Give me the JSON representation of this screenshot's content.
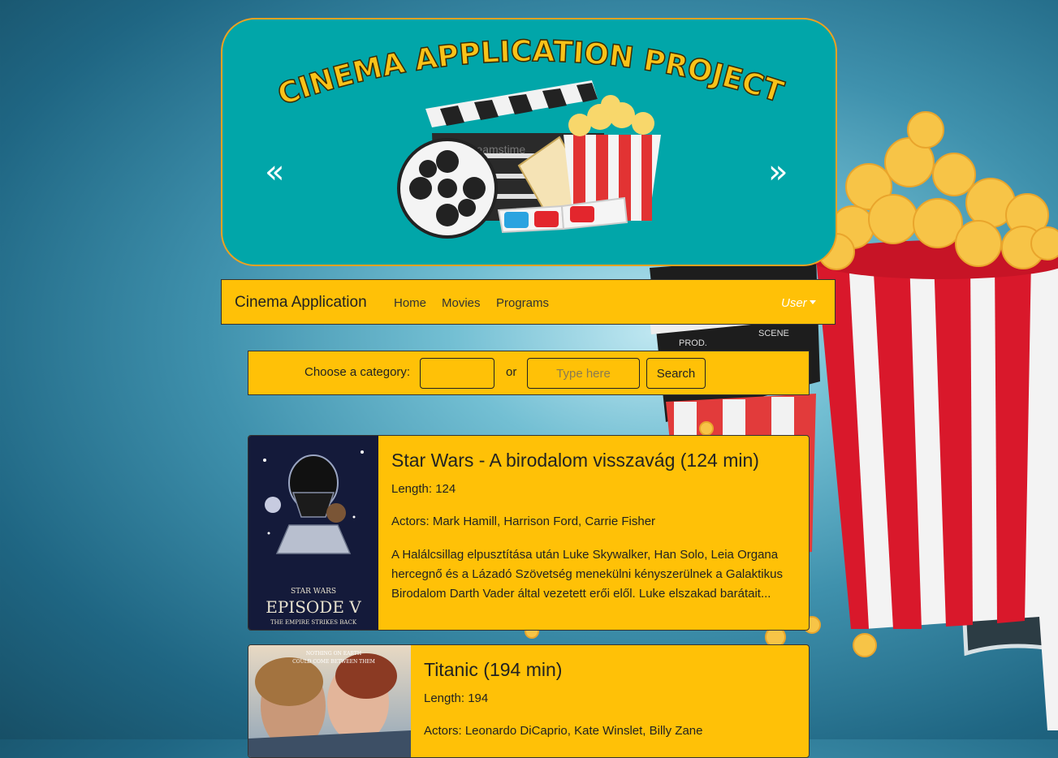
{
  "banner": {
    "title": "CINEMA APPLICATION PROJECT",
    "watermark": "dreamstime",
    "prev_icon": "«",
    "next_icon": "»"
  },
  "navbar": {
    "brand": "Cinema Application",
    "links": [
      "Home",
      "Movies",
      "Programs"
    ],
    "user_label": "User"
  },
  "search": {
    "category_label": "Choose a category:",
    "category_value": "",
    "or_label": "or",
    "input_value": "",
    "input_placeholder": "Type here",
    "button_label": "Search"
  },
  "movies": [
    {
      "title": "Star Wars - A birodalom visszavág (124 min)",
      "length": "Length: 124",
      "actors": "Actors: Mark Hamill, Harrison Ford, Carrie Fisher",
      "description": "A Halálcsillag elpusztítása után Luke Skywalker, Han Solo, Leia Organa hercegnő és a Lázadó Szövetség menekülni kényszerülnek a Galaktikus Birodalom Darth Vader által vezetett erői elől. Luke elszakad barátait...",
      "poster_text": [
        "STAR WARS",
        "EPISODE V",
        "THE EMPIRE STRIKES BACK"
      ]
    },
    {
      "title": "Titanic (194 min)",
      "length": "Length: 194",
      "actors": "Actors: Leonardo DiCaprio, Kate Winslet, Billy Zane",
      "poster_text": [
        "NOTHING ON EARTH",
        "COULD COME BETWEEN THEM"
      ]
    }
  ],
  "colors": {
    "accent": "#ffc107",
    "banner_bg": "#01a6a9",
    "banner_border": "#eda221",
    "page_bg": "#3f91ad"
  }
}
